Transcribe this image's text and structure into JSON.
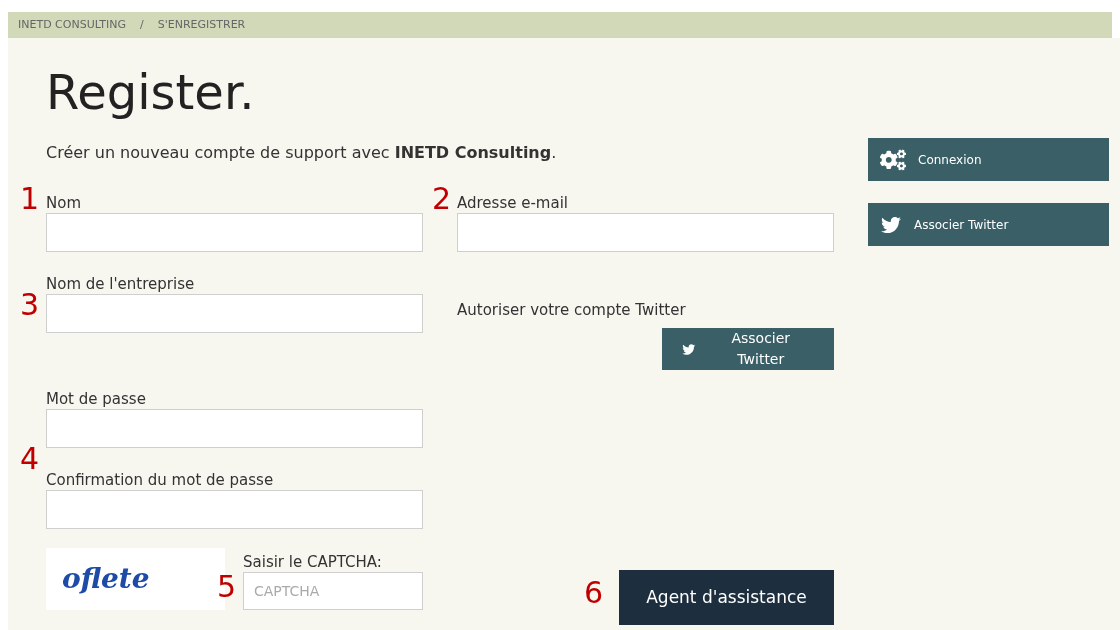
{
  "breadcrumb": [
    "INETD CONSULTING",
    "/",
    "S'ENREGISTRER"
  ],
  "title": "Register.",
  "subtitle": "Créer un nouveau compte de support avec **INETD Consulting**.",
  "fields_left": [
    {
      "label": "Nom"
    },
    {
      "label": "Nom de l'entreprise"
    },
    {
      "label": "Mot de passe"
    },
    {
      "label": "Confirmation du mot de passe"
    }
  ],
  "email_field": {
    "label": "Adresse e-mail"
  },
  "twitter_section": {
    "label": "Autoriser votre compte Twitter",
    "button": "Associer Twitter"
  },
  "captcha": {
    "image_text": "oflete",
    "label": "Saisir le CAPTCHA:",
    "placeholder": "CAPTCHA"
  },
  "submit_button": "Agent d'assistance",
  "sidebar": [
    {
      "kind": "gears",
      "label": "Connexion"
    },
    {
      "kind": "twitter",
      "label": "Associer Twitter"
    }
  ],
  "annotations": [
    "1",
    "2",
    "3",
    "4",
    "5",
    "6"
  ]
}
